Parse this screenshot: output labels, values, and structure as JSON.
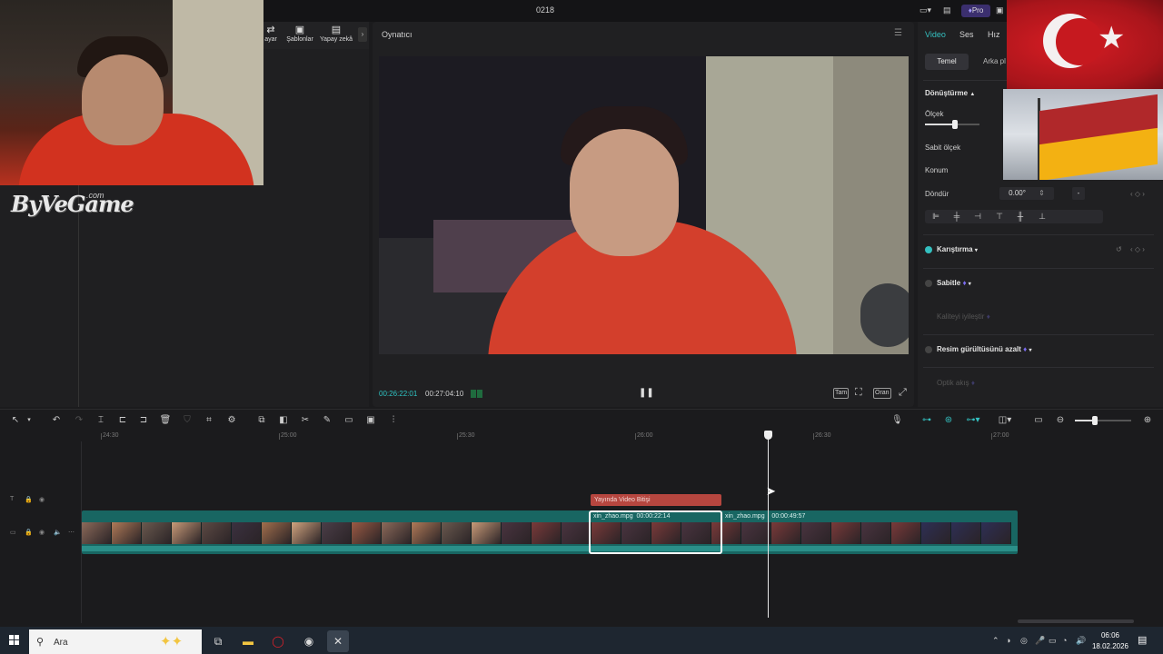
{
  "window": {
    "title": "0218"
  },
  "media_toolbar": {
    "items": [
      {
        "label": "ayar",
        "icon": "adjust-icon"
      },
      {
        "label": "Şablonlar",
        "icon": "template-icon"
      },
      {
        "label": "Yapay zekâ",
        "icon": "ai-icon"
      }
    ]
  },
  "overlay": {
    "logo_text": "ByVeGame",
    "logo_suffix": ".com"
  },
  "player": {
    "title": "Oynatıcı",
    "current_time": "00:26:22:01",
    "total_time": "00:27:04:10",
    "buttons": {
      "full": "Tam",
      "ratio": "Oran"
    }
  },
  "topbar": {
    "pro_label": "Pro"
  },
  "inspector": {
    "tabs": [
      "Video",
      "Ses",
      "Hız"
    ],
    "subtabs": {
      "basic": "Temel",
      "background": "Arka pl"
    },
    "transform": {
      "header": "Dönüştürme",
      "scale_label": "Ölçek",
      "scale_value": 0.55,
      "uniform_scale_label": "Sabit ölçek",
      "position_label": "Konum",
      "rotate_label": "Döndür",
      "rotate_value": "0.00°",
      "rotate_minus": "-"
    },
    "blend_label": "Karıştırma",
    "stabilize_label": "Sabitle",
    "quality_label": "Kaliteyi iyileştir",
    "denoise_label": "Resim gürültüsünü azalt",
    "optical_label": "Optik akış",
    "accent_color": "#34c0c0",
    "premium_color": "#7b6cf0"
  },
  "timeline": {
    "ruler_ticks": [
      "24:30",
      "25:00",
      "25:30",
      "26:00",
      "26:30",
      "27:00"
    ],
    "text_clip": "Yayında Video Bitişi",
    "clips": [
      {
        "label": "xin_zhao.mpg",
        "duration": "00:00:22:14"
      },
      {
        "label": "xin_zhao.mpg",
        "duration": "00:00:49:57"
      }
    ],
    "zoom_value": 0.35,
    "track_color": "#186662",
    "text_clip_color": "#b6463f"
  },
  "taskbar": {
    "search_placeholder": "Ara",
    "time": "06:06",
    "date": "18.02.2026"
  }
}
